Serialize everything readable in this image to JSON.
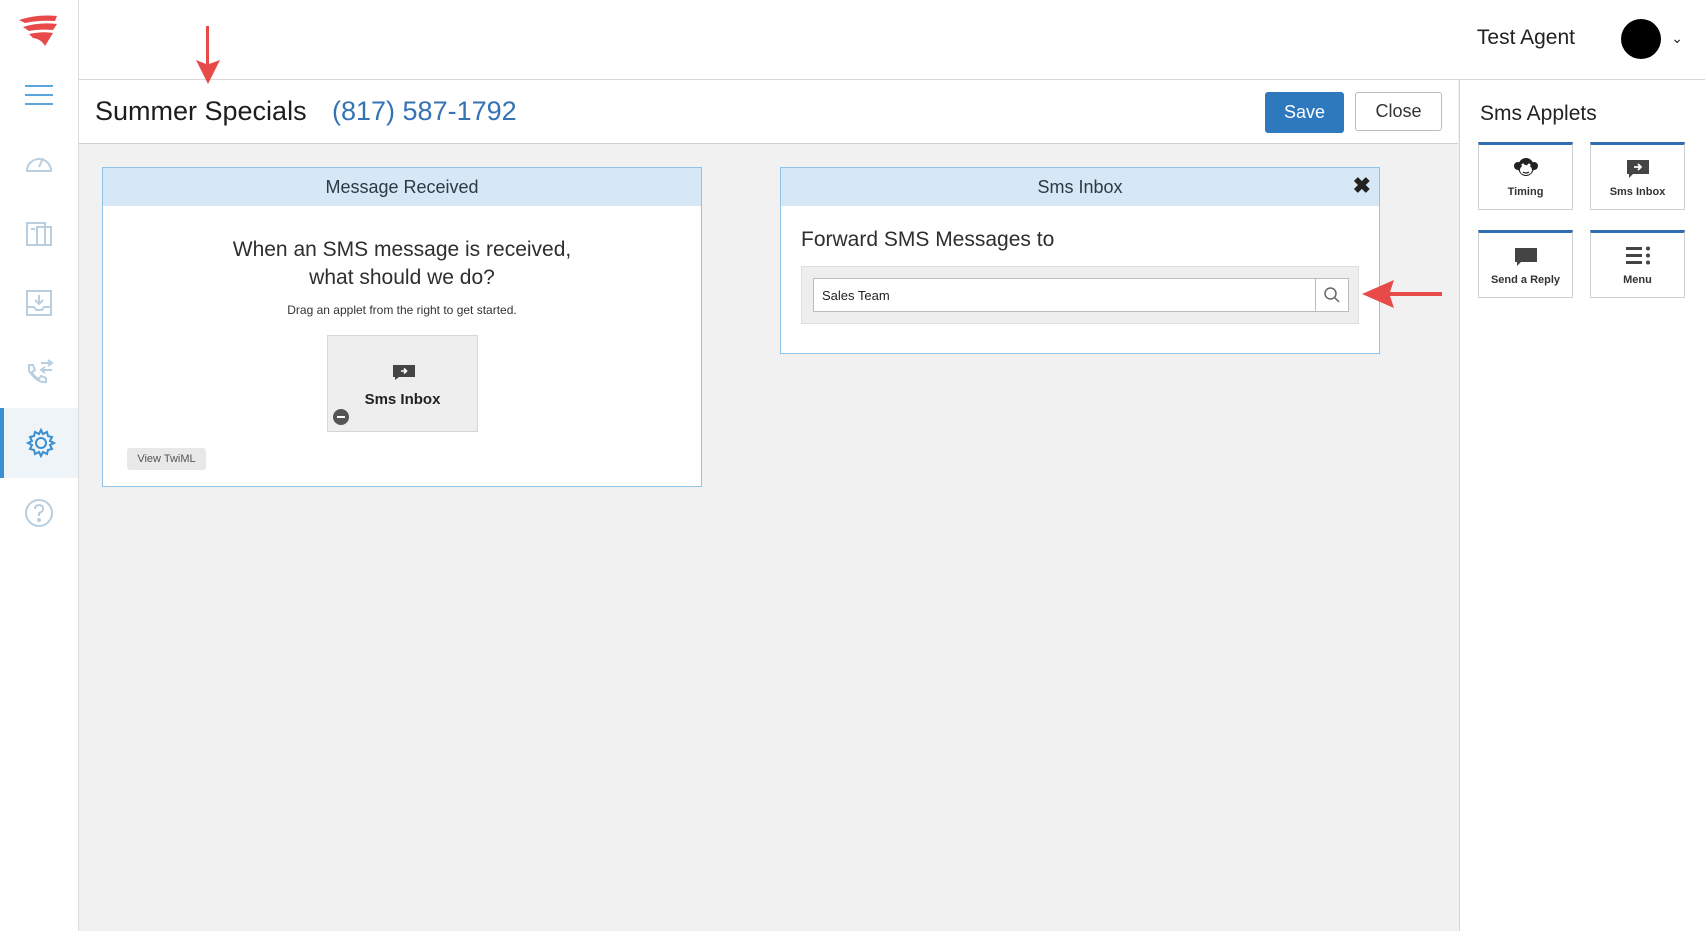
{
  "topbar": {
    "agent_name": "Test Agent",
    "caret": "⌄"
  },
  "title": {
    "name": "Summer Specials",
    "phone": "(817) 587-1792"
  },
  "actions": {
    "save_label": "Save",
    "close_label": "Close"
  },
  "sidebar": {
    "items": [
      {
        "name": "menu-icon"
      },
      {
        "name": "dashboard-icon"
      },
      {
        "name": "contacts-icon"
      },
      {
        "name": "inbox-icon"
      },
      {
        "name": "call-transfer-icon"
      },
      {
        "name": "settings-icon",
        "active": true
      },
      {
        "name": "help-icon"
      }
    ]
  },
  "applets_panel": {
    "title": "Sms Applets",
    "items": [
      {
        "label": "Timing",
        "icon": "monkey-icon"
      },
      {
        "label": "Sms Inbox",
        "icon": "message-forward-icon"
      },
      {
        "label": "Send a Reply",
        "icon": "message-icon"
      },
      {
        "label": "Menu",
        "icon": "menu-list-icon"
      }
    ]
  },
  "message_received": {
    "header": "Message Received",
    "prompt_line1": "When an SMS message is received,",
    "prompt_line2": "what should we do?",
    "hint": "Drag an applet from the right to get started.",
    "dropped_applet": "Sms Inbox",
    "twiml_label": "View TwiML"
  },
  "sms_inbox": {
    "header": "Sms Inbox",
    "close_glyph": "✖",
    "forward_label": "Forward SMS Messages to",
    "forward_value": "Sales Team"
  },
  "colors": {
    "accent": "#2e78bd",
    "phone": "#3573b4",
    "card_header": "#d6e8f5",
    "annotation_arrow": "#e84a4a"
  }
}
